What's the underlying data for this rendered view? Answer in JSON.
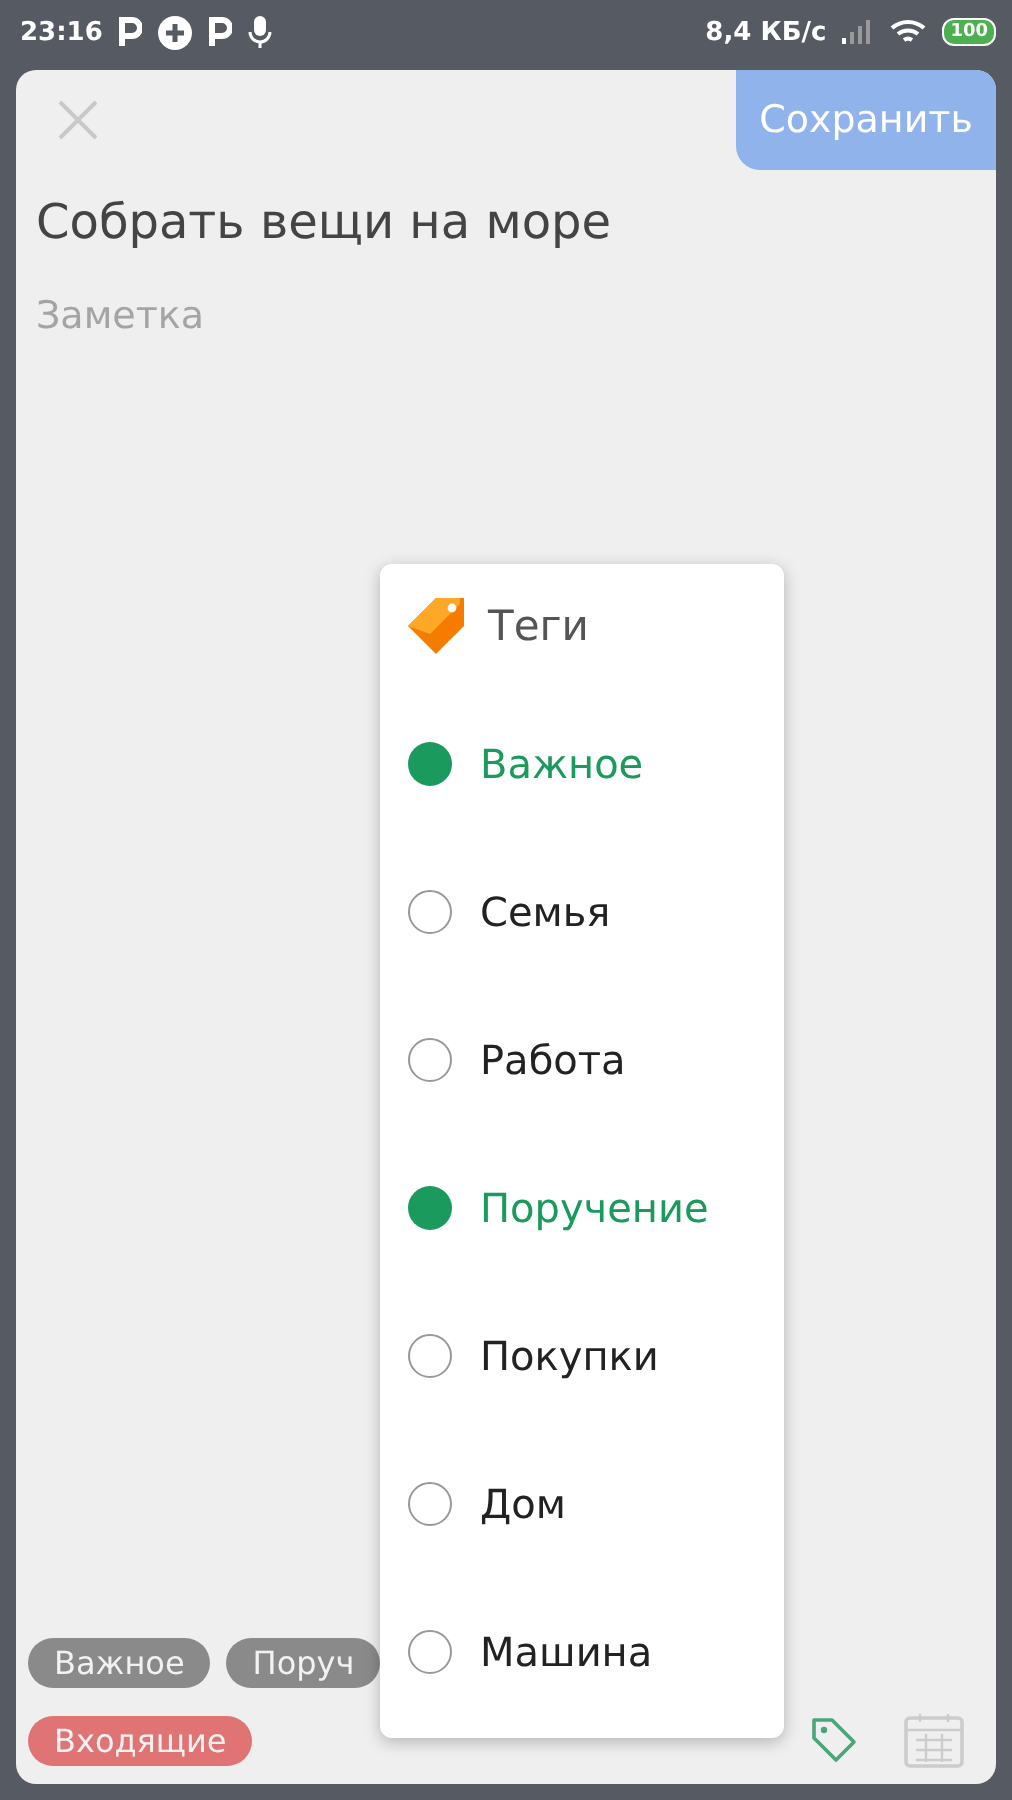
{
  "status_bar": {
    "time": "23:16",
    "speed": "8,4 КБ/с",
    "battery": "100"
  },
  "header": {
    "save_label": "Сохранить"
  },
  "title": {
    "value": "Собрать вещи на море"
  },
  "note": {
    "placeholder": "Заметка"
  },
  "chips": [
    {
      "label": "Важное"
    },
    {
      "label": "Поруч"
    }
  ],
  "project": {
    "label": "Входящие",
    "color": "#e07474"
  },
  "tags_menu": {
    "title": "Теги",
    "items": [
      {
        "label": "Важное",
        "selected": true
      },
      {
        "label": "Семья",
        "selected": false
      },
      {
        "label": "Работа",
        "selected": false
      },
      {
        "label": "Поручение",
        "selected": true
      },
      {
        "label": "Покупки",
        "selected": false
      },
      {
        "label": "Дом",
        "selected": false
      },
      {
        "label": "Машина",
        "selected": false
      }
    ]
  }
}
